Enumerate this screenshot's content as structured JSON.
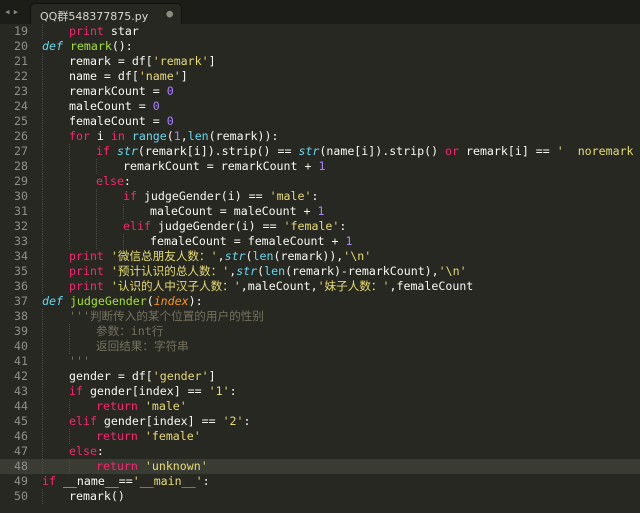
{
  "tab": {
    "title": "QQ群548377875.py",
    "close": "●",
    "arrows": "◂▸"
  },
  "lines": [
    {
      "n": "19",
      "indent": 1,
      "parts": [
        [
          "kw",
          "print"
        ],
        [
          "p",
          " star"
        ]
      ]
    },
    {
      "n": "20",
      "indent": 0,
      "parts": [
        [
          "def",
          "def"
        ],
        [
          "p",
          " "
        ],
        [
          "fn",
          "remark"
        ],
        [
          "p",
          "():"
        ]
      ]
    },
    {
      "n": "21",
      "indent": 1,
      "parts": [
        [
          "p",
          "remark = df["
        ],
        [
          "str",
          "'remark'"
        ],
        [
          "p",
          "]"
        ]
      ]
    },
    {
      "n": "22",
      "indent": 1,
      "parts": [
        [
          "p",
          "name = df["
        ],
        [
          "str",
          "'name'"
        ],
        [
          "p",
          "]"
        ]
      ]
    },
    {
      "n": "23",
      "indent": 1,
      "parts": [
        [
          "p",
          "remarkCount = "
        ],
        [
          "num",
          "0"
        ]
      ]
    },
    {
      "n": "24",
      "indent": 1,
      "parts": [
        [
          "p",
          "maleCount = "
        ],
        [
          "num",
          "0"
        ]
      ]
    },
    {
      "n": "25",
      "indent": 1,
      "parts": [
        [
          "p",
          "femaleCount = "
        ],
        [
          "num",
          "0"
        ]
      ]
    },
    {
      "n": "26",
      "indent": 1,
      "parts": [
        [
          "kw",
          "for"
        ],
        [
          "p",
          " i "
        ],
        [
          "kw",
          "in"
        ],
        [
          "p",
          " "
        ],
        [
          "bi",
          "range"
        ],
        [
          "p",
          "("
        ],
        [
          "num",
          "1"
        ],
        [
          "p",
          ","
        ],
        [
          "bi",
          "len"
        ],
        [
          "p",
          "(remark)):"
        ]
      ]
    },
    {
      "n": "27",
      "indent": 2,
      "parts": [
        [
          "kw",
          "if"
        ],
        [
          "p",
          " "
        ],
        [
          "bi-it",
          "str"
        ],
        [
          "p",
          "(remark[i]).strip() == "
        ],
        [
          "bi-it",
          "str"
        ],
        [
          "p",
          "(name[i]).strip() "
        ],
        [
          "kw",
          "or"
        ],
        [
          "p",
          " remark[i] == "
        ],
        [
          "str",
          "'  noremark  '"
        ],
        [
          "p",
          ":"
        ]
      ]
    },
    {
      "n": "28",
      "indent": 3,
      "parts": [
        [
          "p",
          "remarkCount = remarkCount + "
        ],
        [
          "num",
          "1"
        ]
      ]
    },
    {
      "n": "29",
      "indent": 2,
      "parts": [
        [
          "kw",
          "else"
        ],
        [
          "p",
          ":"
        ]
      ]
    },
    {
      "n": "30",
      "indent": 3,
      "parts": [
        [
          "kw",
          "if"
        ],
        [
          "p",
          " judgeGender(i) == "
        ],
        [
          "str",
          "'male'"
        ],
        [
          "p",
          ":"
        ]
      ]
    },
    {
      "n": "31",
      "indent": 4,
      "parts": [
        [
          "p",
          "maleCount = maleCount + "
        ],
        [
          "num",
          "1"
        ]
      ]
    },
    {
      "n": "32",
      "indent": 3,
      "parts": [
        [
          "kw",
          "elif"
        ],
        [
          "p",
          " judgeGender(i) == "
        ],
        [
          "str",
          "'female'"
        ],
        [
          "p",
          ":"
        ]
      ]
    },
    {
      "n": "33",
      "indent": 4,
      "parts": [
        [
          "p",
          "femaleCount = femaleCount + "
        ],
        [
          "num",
          "1"
        ]
      ]
    },
    {
      "n": "34",
      "indent": 1,
      "parts": [
        [
          "kw",
          "print"
        ],
        [
          "p",
          " "
        ],
        [
          "str",
          "'微信总朋友人数：'"
        ],
        [
          "p",
          ","
        ],
        [
          "bi-it",
          "str"
        ],
        [
          "p",
          "("
        ],
        [
          "bi",
          "len"
        ],
        [
          "p",
          "(remark)),"
        ],
        [
          "str",
          "'\\n'"
        ]
      ]
    },
    {
      "n": "35",
      "indent": 1,
      "parts": [
        [
          "kw",
          "print"
        ],
        [
          "p",
          " "
        ],
        [
          "str",
          "'预计认识的总人数：'"
        ],
        [
          "p",
          ","
        ],
        [
          "bi-it",
          "str"
        ],
        [
          "p",
          "("
        ],
        [
          "bi",
          "len"
        ],
        [
          "p",
          "(remark)-remarkCount),"
        ],
        [
          "str",
          "'\\n'"
        ]
      ]
    },
    {
      "n": "36",
      "indent": 1,
      "parts": [
        [
          "kw",
          "print"
        ],
        [
          "p",
          " "
        ],
        [
          "str",
          "'认识的人中汉子人数：'"
        ],
        [
          "p",
          ",maleCount,"
        ],
        [
          "str",
          "'妹子人数：'"
        ],
        [
          "p",
          ",femaleCount"
        ]
      ]
    },
    {
      "n": "37",
      "indent": 0,
      "parts": [
        [
          "def",
          "def"
        ],
        [
          "p",
          " "
        ],
        [
          "fn",
          "judgeGender"
        ],
        [
          "p",
          "("
        ],
        [
          "param",
          "index"
        ],
        [
          "p",
          "):"
        ]
      ]
    },
    {
      "n": "38",
      "indent": 1,
      "parts": [
        [
          "cmt",
          "'''判断传入的某个位置的用户的性别"
        ]
      ]
    },
    {
      "n": "39",
      "indent": 2,
      "parts": [
        [
          "cmt",
          "参数：int行"
        ]
      ]
    },
    {
      "n": "40",
      "indent": 2,
      "parts": [
        [
          "cmt",
          "返回结果：字符串"
        ]
      ]
    },
    {
      "n": "41",
      "indent": 1,
      "parts": [
        [
          "cmt",
          "'''"
        ]
      ]
    },
    {
      "n": "42",
      "indent": 1,
      "parts": [
        [
          "p",
          "gender = df["
        ],
        [
          "str",
          "'gender'"
        ],
        [
          "p",
          "]"
        ]
      ]
    },
    {
      "n": "43",
      "indent": 1,
      "parts": [
        [
          "kw",
          "if"
        ],
        [
          "p",
          " gender[index] == "
        ],
        [
          "str",
          "'1'"
        ],
        [
          "p",
          ":"
        ]
      ]
    },
    {
      "n": "44",
      "indent": 2,
      "parts": [
        [
          "kw",
          "return"
        ],
        [
          "p",
          " "
        ],
        [
          "str",
          "'male'"
        ]
      ]
    },
    {
      "n": "45",
      "indent": 1,
      "parts": [
        [
          "kw",
          "elif"
        ],
        [
          "p",
          " gender[index] == "
        ],
        [
          "str",
          "'2'"
        ],
        [
          "p",
          ":"
        ]
      ]
    },
    {
      "n": "46",
      "indent": 2,
      "parts": [
        [
          "kw",
          "return"
        ],
        [
          "p",
          " "
        ],
        [
          "str",
          "'female'"
        ]
      ]
    },
    {
      "n": "47",
      "indent": 1,
      "parts": [
        [
          "kw",
          "else"
        ],
        [
          "p",
          ":"
        ]
      ]
    },
    {
      "n": "48",
      "indent": 2,
      "parts": [
        [
          "kw",
          "return"
        ],
        [
          "p",
          " "
        ],
        [
          "str",
          "'unknown'"
        ]
      ],
      "highlight": true
    },
    {
      "n": "49",
      "indent": 0,
      "parts": [
        [
          "kw",
          "if"
        ],
        [
          "p",
          " __name__=="
        ],
        [
          "str",
          "'__main__'"
        ],
        [
          "p",
          ":"
        ]
      ]
    },
    {
      "n": "50",
      "indent": 1,
      "parts": [
        [
          "p",
          "remark()"
        ]
      ]
    }
  ],
  "colors": {
    "background": "#272822",
    "keyword": "#f92672",
    "string": "#e6db74",
    "number": "#ae81ff",
    "function": "#a6e22e",
    "builtin": "#66d9ef",
    "comment": "#75715e",
    "parameter": "#fd971f"
  }
}
